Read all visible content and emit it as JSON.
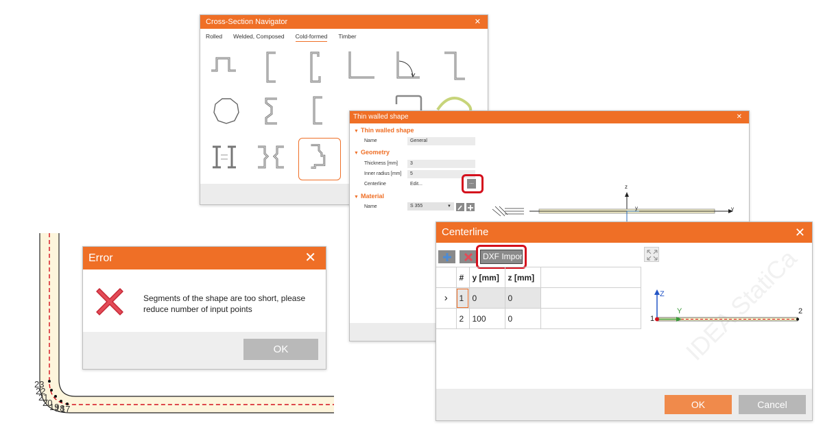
{
  "navigator": {
    "title": "Cross-Section Navigator",
    "close": "✕",
    "tabs": [
      "Rolled",
      "Welded, Composed",
      "Cold-formed",
      "Timber"
    ],
    "active_tab": "Cold-formed"
  },
  "thin": {
    "title": "Thin walled shape",
    "close": "✕",
    "sections": {
      "thin": "Thin walled shape",
      "geometry": "Geometry",
      "material": "Material"
    },
    "fields": {
      "name_label": "Name",
      "name_value": "General",
      "thickness_label": "Thickness [mm]",
      "thickness_value": "3",
      "radius_label": "Inner radius [mm]",
      "radius_value": "5",
      "centerline_label": "Centerline",
      "centerline_value": "Edit...",
      "dots": "...",
      "material_label": "Name",
      "material_value": "S 355"
    },
    "preview": {
      "z": "z",
      "y": "y",
      "y2": "y"
    }
  },
  "centerline": {
    "title": "Centerline",
    "close": "✕",
    "dxf_label": "DXF Impor",
    "columns": [
      "#",
      "y [mm]",
      "z [mm]"
    ],
    "rows": [
      {
        "num": "1",
        "y": "0",
        "z": "0"
      },
      {
        "num": "2",
        "y": "100",
        "z": "0"
      }
    ],
    "preview": {
      "z": "Z",
      "y": "Y",
      "p1": "1",
      "p2": "2"
    },
    "ok": "OK",
    "cancel": "Cancel",
    "watermark": "IDEA StatiCa"
  },
  "error": {
    "title": "Error",
    "close": "✕",
    "message": "Segments of the shape are too short, please reduce number of input points",
    "ok": "OK"
  },
  "bg_labels": [
    "23",
    "22",
    "21",
    "20",
    "19",
    "18",
    "17"
  ],
  "colors": {
    "accent": "#ef6f26",
    "highlight": "#d40f1c",
    "danger_icon": "#e34b57"
  }
}
